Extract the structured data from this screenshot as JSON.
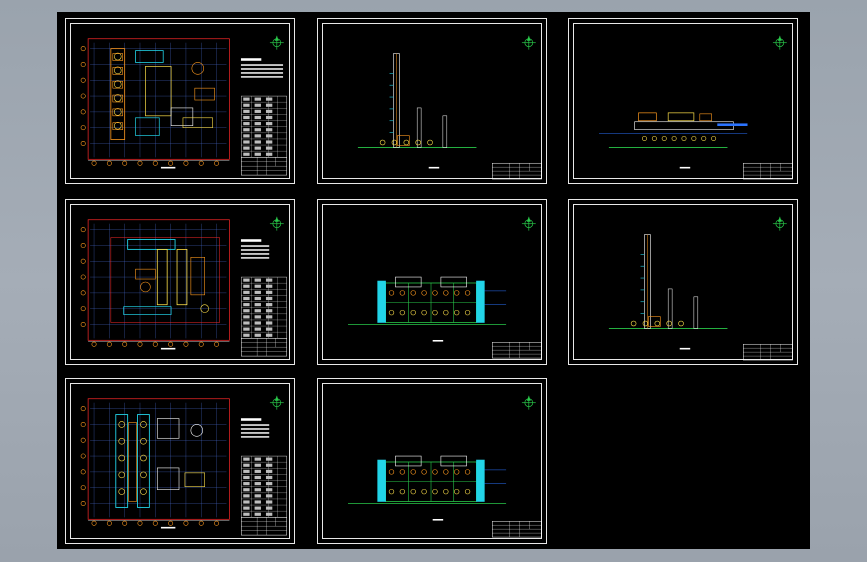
{
  "viewer": {
    "background_color": "#000000",
    "sheet_border_color": "#e8e8e8",
    "sheet_count": 8
  },
  "sheets": [
    {
      "id": "plan-1",
      "kind": "plan"
    },
    {
      "id": "elevation-1",
      "kind": "tower-elevation"
    },
    {
      "id": "elevation-2",
      "kind": "low-elevation"
    },
    {
      "id": "plan-2",
      "kind": "plan"
    },
    {
      "id": "section-1",
      "kind": "section"
    },
    {
      "id": "elevation-3",
      "kind": "tower-elevation"
    },
    {
      "id": "plan-3",
      "kind": "plan"
    },
    {
      "id": "section-2",
      "kind": "section"
    }
  ],
  "icons": {
    "north_arrow": "compass-icon"
  },
  "colors": {
    "frame": "#e8e8e8",
    "red_boundary": "#ff2a2a",
    "orange": "#ff9a1e",
    "yellow": "#ffe14a",
    "cyan": "#22d4e8",
    "green": "#29c94a",
    "blue": "#2c74ff",
    "white": "#ffffff"
  }
}
